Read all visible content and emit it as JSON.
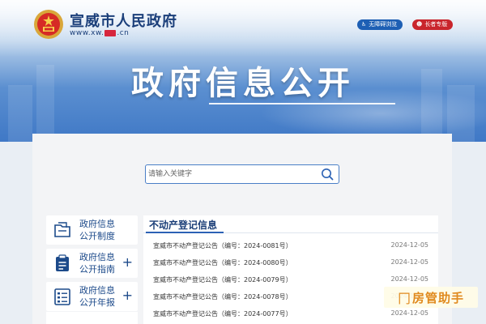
{
  "header": {
    "site_name": "宣威市人民政府",
    "url_prefix": "www.xw.",
    "url_suffix": ".cn",
    "accessibility_label": "无障碍浏览",
    "elder_label": "长者专版"
  },
  "hero": {
    "title": "政府信息公开"
  },
  "search": {
    "placeholder": "请输入关键字"
  },
  "sidebar": {
    "items": [
      {
        "label_line1": "政府信息",
        "label_line2": "公开制度",
        "icon": "document-folder-icon",
        "expandable": false
      },
      {
        "label_line1": "政府信息",
        "label_line2": "公开指南",
        "icon": "clipboard-icon",
        "expandable": true
      },
      {
        "label_line1": "政府信息",
        "label_line2": "公开年报",
        "icon": "report-list-icon",
        "expandable": true
      }
    ],
    "plus_symbol": "+"
  },
  "list": {
    "heading": "不动产登记信息",
    "rows": [
      {
        "title": "宣威市不动产登记公告（编号：2024-0081号）",
        "date": "2024-12-05"
      },
      {
        "title": "宣威市不动产登记公告（编号：2024-0080号）",
        "date": "2024-12-05"
      },
      {
        "title": "宣威市不动产登记公告（编号：2024-0079号）",
        "date": "2024-12-05"
      },
      {
        "title": "宣威市不动产登记公告（编号：2024-0078号）",
        "date": "2024-12-05"
      },
      {
        "title": "宣威市不动产登记公告（编号：2024-0077号）",
        "date": "2024-12-05"
      }
    ]
  },
  "watermark": {
    "text": "房管助手",
    "icon": "door-icon"
  },
  "colors": {
    "primary": "#1c4a8a",
    "accent_red": "#c9252c",
    "link_blue": "#1d5fb4"
  }
}
